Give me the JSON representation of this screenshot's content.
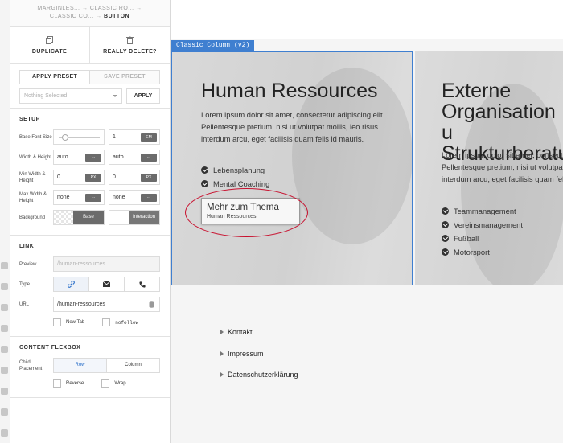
{
  "breadcrumb": {
    "items": [
      "MARGINLES...",
      "CLASSIC RO...",
      "CLASSIC CO...",
      "BUTTON"
    ],
    "separator": "→"
  },
  "actions": {
    "duplicate": "DUPLICATE",
    "delete": "REALLY DELETE?"
  },
  "preset": {
    "apply_tab": "APPLY PRESET",
    "save_tab": "SAVE PRESET",
    "select_placeholder": "Nothing Selected",
    "apply_button": "APPLY"
  },
  "setup": {
    "title": "SETUP",
    "base_font_size": {
      "label": "Base Font Size",
      "value": "1",
      "unit": "EM"
    },
    "width_height": {
      "label": "Width & Height",
      "width": "auto",
      "height": "auto",
      "unit": "···"
    },
    "min_width_height": {
      "label": "Min Width & Height",
      "width": "0",
      "height": "0",
      "unit": "PX"
    },
    "max_width_height": {
      "label": "Max Width & Height",
      "width": "none",
      "height": "none",
      "unit": "···"
    },
    "background": {
      "label": "Background",
      "base": "Base",
      "interaction": "Interaction"
    }
  },
  "link": {
    "title": "LINK",
    "preview_label": "Preview",
    "preview_value": "/human-ressources",
    "type_label": "Type",
    "type_options": [
      "link-icon",
      "mail-icon",
      "phone-icon"
    ],
    "url_label": "URL",
    "url_value": "/human-ressources",
    "new_tab": "New Tab",
    "nofollow": "nofollow"
  },
  "flexbox": {
    "title": "CONTENT FLEXBOX",
    "child_placement_label": "Child Placement",
    "row": "Row",
    "column": "Column",
    "reverse": "Reverse",
    "wrap": "Wrap"
  },
  "canvas": {
    "column_label": "Classic Column (v2)",
    "col1": {
      "title": "Human Ressources",
      "body": "Lorem ipsum dolor sit amet, consectetur adipiscing elit. Pellentesque pretium, nisi ut volutpat mollis, leo risus interdum arcu, eget facilisis quam felis id mauris.",
      "bullets": [
        "Lebensplanung",
        "Mental Coaching"
      ],
      "button_title": "Mehr zum Thema",
      "button_sub": "Human Ressources"
    },
    "col2": {
      "title_lines": [
        "Externe",
        "Organisation u",
        "Strukturberatu"
      ],
      "body": "Lorem ipsum dolor sit amet, consectetur adipiscing elit. Pellentesque pretium, nisi ut volutpat mollis, leo risus interdum arcu, eget facilisis quam felis id mauris.",
      "bullets": [
        "Teammanagement",
        "Vereinsmanagement",
        "Fußball",
        "Motorsport"
      ]
    },
    "footer_links": [
      "Kontakt",
      "Impressum",
      "Datenschutzerklärung"
    ]
  },
  "colors": {
    "selection": "#3f7fd0",
    "annotation_ring": "#c8102e",
    "accent": "#2a6fc9"
  }
}
